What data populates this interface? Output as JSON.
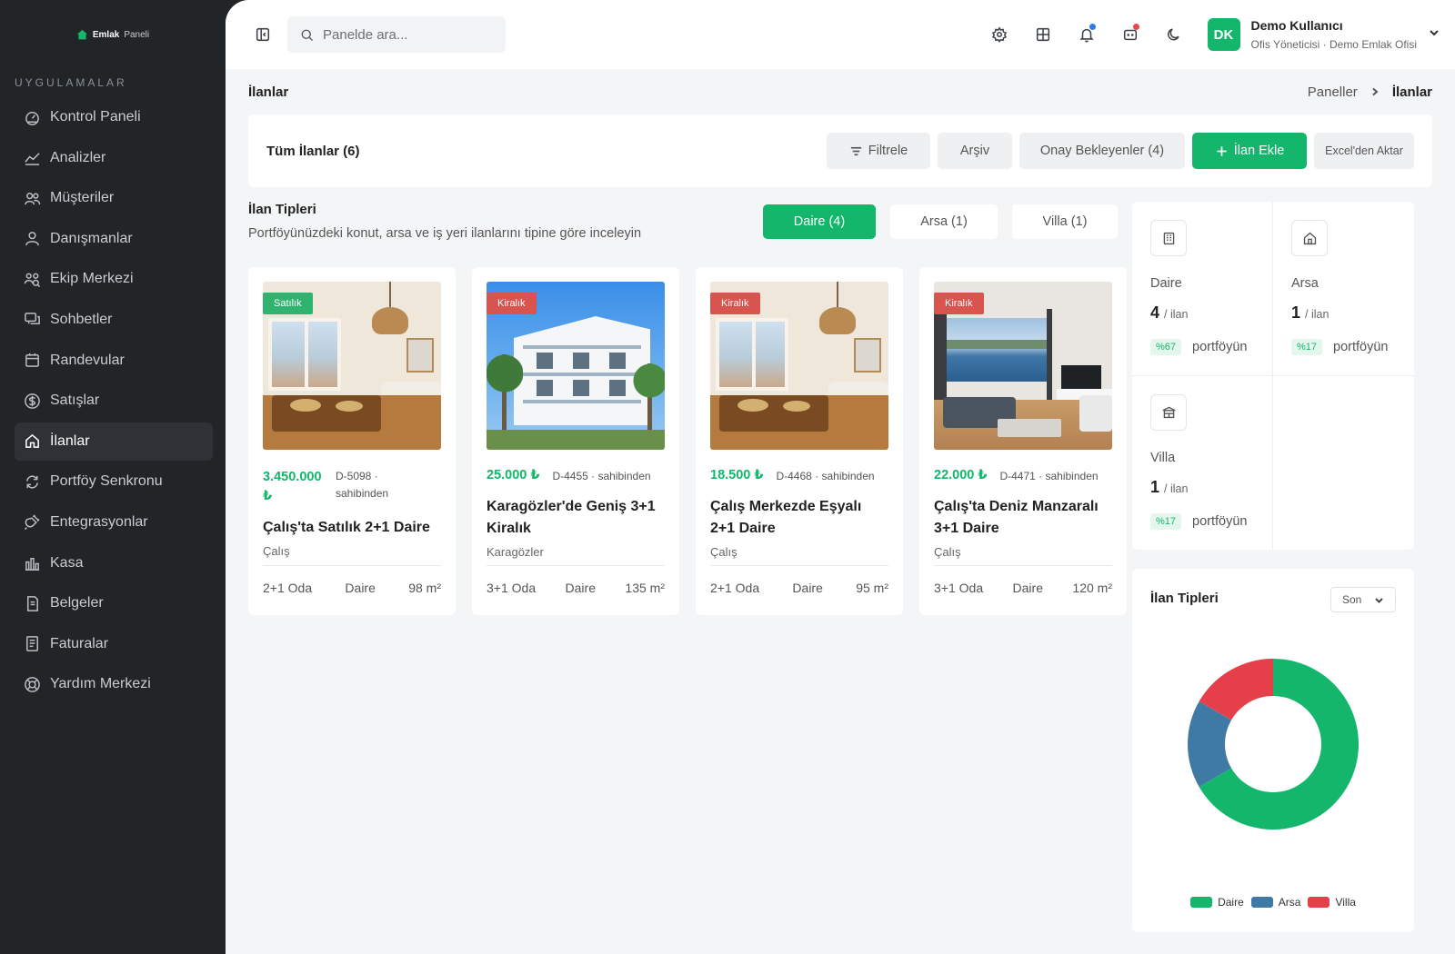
{
  "brand": {
    "name": "Emlak",
    "suffix": "Paneli"
  },
  "sidebar": {
    "section_title": "UYGULAMALAR",
    "items": [
      {
        "label": "Kontrol Paneli",
        "icon": "dashboard-icon"
      },
      {
        "label": "Analizler",
        "icon": "chart-line-icon"
      },
      {
        "label": "Müşteriler",
        "icon": "users-icon"
      },
      {
        "label": "Danışmanlar",
        "icon": "user-icon"
      },
      {
        "label": "Ekip Merkezi",
        "icon": "team-icon"
      },
      {
        "label": "Sohbetler",
        "icon": "chat-icon"
      },
      {
        "label": "Randevular",
        "icon": "calendar-icon"
      },
      {
        "label": "Satışlar",
        "icon": "dollar-icon"
      },
      {
        "label": "İlanlar",
        "icon": "home-icon",
        "active": true
      },
      {
        "label": "Portföy Senkronu",
        "icon": "sync-icon"
      },
      {
        "label": "Entegrasyonlar",
        "icon": "plug-icon"
      },
      {
        "label": "Kasa",
        "icon": "bar-chart-icon"
      },
      {
        "label": "Belgeler",
        "icon": "document-icon"
      },
      {
        "label": "Faturalar",
        "icon": "invoice-icon"
      },
      {
        "label": "Yardım Merkezi",
        "icon": "lifebuoy-icon"
      }
    ]
  },
  "topbar": {
    "search_placeholder": "Panelde ara...",
    "user": {
      "initials": "DK",
      "name": "Demo Kullanıcı",
      "role": "Ofis Yöneticisi · Demo Emlak Ofisi"
    },
    "notification_dot_color": "#2d7be5",
    "message_dot_color": "#e5484d"
  },
  "page": {
    "title": "İlanlar",
    "breadcrumb": [
      "Paneller",
      "İlanlar"
    ]
  },
  "toolbar": {
    "title": "Tüm İlanlar (6)",
    "filter_label": "Filtrele",
    "archive_label": "Arşiv",
    "pending_label": "Onay Bekleyenler (4)",
    "add_label": "İlan Ekle",
    "excel_label": "Excel'den Aktar"
  },
  "types": {
    "title": "İlan Tipleri",
    "subtitle": "Portföyünüzdeki konut, arsa ve iş yeri ilanlarını tipine göre inceleyin",
    "tabs": [
      {
        "label": "Daire (4)",
        "active": true
      },
      {
        "label": "Arsa (1)",
        "active": false
      },
      {
        "label": "Villa (1)",
        "active": false
      }
    ]
  },
  "listings": [
    {
      "badge": "Satılık",
      "badge_color": "#2fb36f",
      "price": "3.450.000 ₺",
      "ref": "D-5098 · sahibinden",
      "title": "Çalış'ta Satılık 2+1 Daire",
      "location": "Çalış",
      "rooms": "2+1 Oda",
      "type": "Daire",
      "area": "98 m²",
      "photo": "interior"
    },
    {
      "badge": "Kiralık",
      "badge_color": "#d9534f",
      "price": "25.000 ₺",
      "ref": "D-4455 · sahibinden",
      "title": "Karagözler'de Geniş 3+1 Kiralık",
      "location": "Karagözler",
      "rooms": "3+1 Oda",
      "type": "Daire",
      "area": "135 m²",
      "photo": "building"
    },
    {
      "badge": "Kiralık",
      "badge_color": "#d9534f",
      "price": "18.500 ₺",
      "ref": "D-4468 · sahibinden",
      "title": "Çalış Merkezde Eşyalı 2+1 Daire",
      "location": "Çalış",
      "rooms": "2+1 Oda",
      "type": "Daire",
      "area": "95 m²",
      "photo": "interior"
    },
    {
      "badge": "Kiralık",
      "badge_color": "#d9534f",
      "price": "22.000 ₺",
      "ref": "D-4471 · sahibinden",
      "title": "Çalış'ta Deniz Manzaralı 3+1 Daire",
      "location": "Çalış",
      "rooms": "3+1 Oda",
      "type": "Daire",
      "area": "120 m²",
      "photo": "seaview"
    }
  ],
  "stats": [
    {
      "label": "Daire",
      "count": "4",
      "unit": "/ ilan",
      "pct": "%67",
      "share_label": "portföyün",
      "icon": "building-icon"
    },
    {
      "label": "Arsa",
      "count": "1",
      "unit": "/ ilan",
      "pct": "%17",
      "share_label": "portföyün",
      "icon": "house-icon"
    },
    {
      "label": "Villa",
      "count": "1",
      "unit": "/ ilan",
      "pct": "%17",
      "share_label": "portföyün",
      "icon": "villa-icon"
    }
  ],
  "donut": {
    "title": "İlan Tipleri",
    "select_value": "Son"
  },
  "chart_data": {
    "type": "pie",
    "categories": [
      "Daire",
      "Arsa",
      "Villa"
    ],
    "values": [
      4,
      1,
      1
    ],
    "colors": [
      "#13b66b",
      "#3f7aa5",
      "#e5404a"
    ],
    "legend": "bottom"
  }
}
